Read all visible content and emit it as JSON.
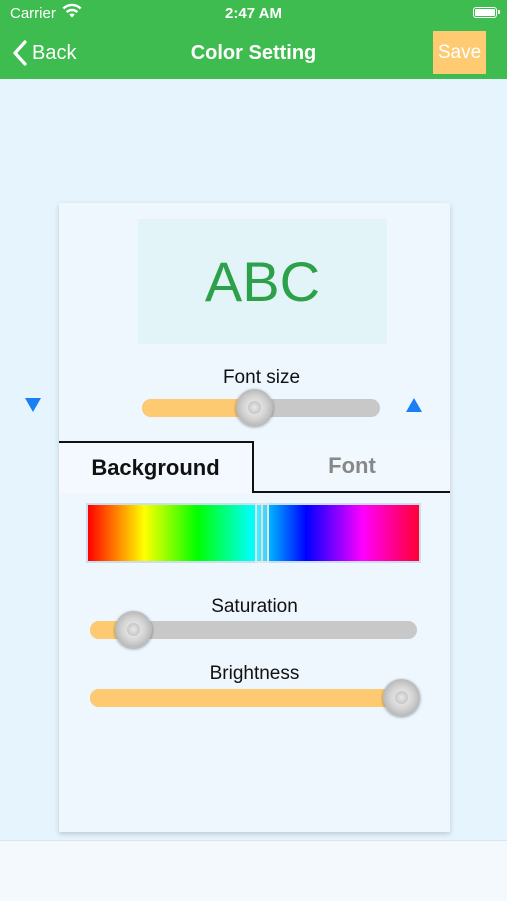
{
  "status": {
    "carrier": "Carrier",
    "time": "2:47 AM"
  },
  "nav": {
    "back_label": "Back",
    "title": "Color Setting",
    "save_label": "Save"
  },
  "preview": {
    "text": "ABC",
    "text_color": "#2da149"
  },
  "font_size": {
    "label": "Font size",
    "level": 0.47
  },
  "tabs": [
    {
      "label": "Background",
      "selected": true
    },
    {
      "label": "Font",
      "selected": false
    }
  ],
  "hue": {
    "level": 0.52
  },
  "saturation": {
    "label": "Saturation",
    "level": 0.13
  },
  "brightness": {
    "label": "Brightness",
    "level": 0.95
  },
  "colors": {
    "nav_bg": "#3ebc50",
    "save_bg": "#fecb72",
    "slider_fill": "#fdca72",
    "slider_track": "#c8c8c8",
    "arrow": "#1a7ef5"
  },
  "icons": {
    "back": "chevron-left-icon",
    "wifi": "wifi-icon",
    "battery": "battery-icon",
    "decrease": "triangle-down-icon",
    "increase": "triangle-up-icon"
  }
}
